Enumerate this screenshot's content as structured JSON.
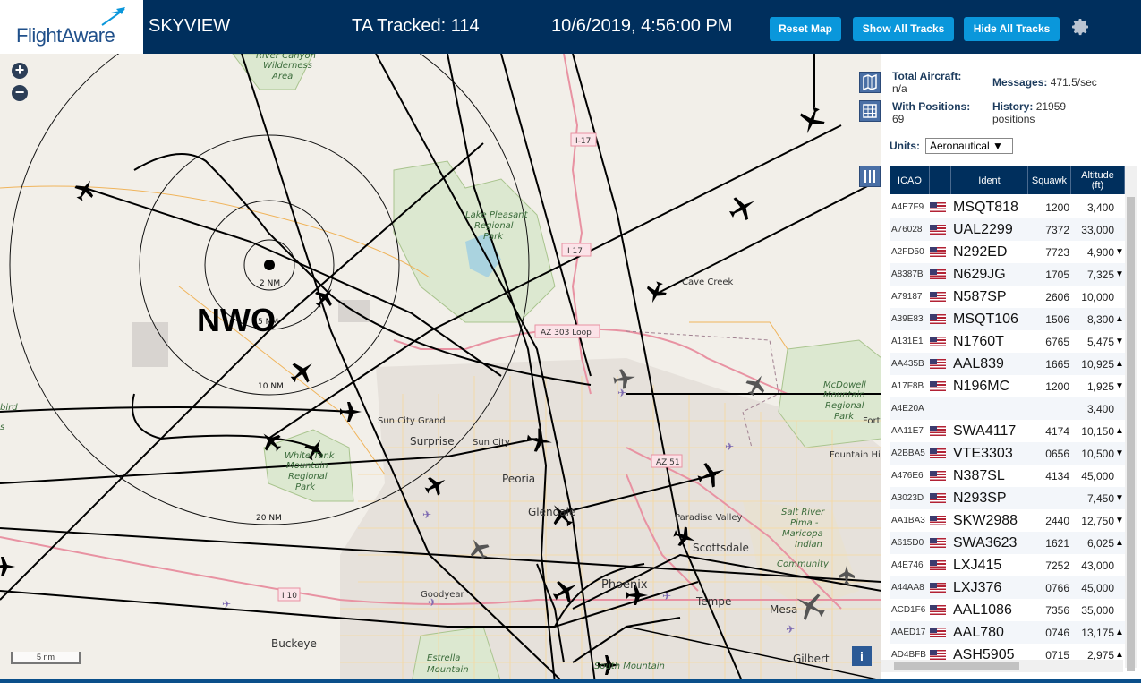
{
  "header": {
    "logo_text": "FlightAware",
    "app_title": "SKYVIEW",
    "tracked": "TA Tracked: 114",
    "datetime": "10/6/2019, 4:56:00 PM",
    "reset_label": "Reset Map",
    "show_label": "Show All Tracks",
    "hide_label": "Hide All Tracks",
    "brand_color": "#002f5d",
    "button_color": "#0a97db"
  },
  "map": {
    "zoom_in": "+",
    "zoom_out": "−",
    "scale_label": "5 nm",
    "info_label": "i",
    "station_label": "NWO",
    "ring_labels": [
      "2 NM",
      "5 NM",
      "10 NM",
      "20 NM"
    ],
    "places": [
      "River Canyon Wilderness Area",
      "Lake Pleasant Regional Park",
      "Cave Creek",
      "AZ 303 Loop",
      "McDowell Mountain Regional Park",
      "Sun City Grand",
      "Surprise",
      "Sun City",
      "White Tank Mountain Regional Park",
      "Peoria",
      "AZ 51",
      "Fountain Hills",
      "Glendale",
      "Paradise Valley",
      "Salt River Pima-Maricopa Indian Community",
      "Scottsdale",
      "I 10",
      "Goodyear",
      "Phoenix",
      "Tempe",
      "Mesa",
      "Buckeye",
      "Estrella Mountain",
      "Gilbert",
      "South Mountain",
      "I-17",
      "I 17",
      "Fort"
    ],
    "places_visible": [
      "River Canyon",
      "Wilderness",
      "Area",
      "Lake Pleasant",
      "Regional",
      "Park",
      "Cave Creek",
      "AZ 303 Loop",
      "McDowell",
      "Mountain",
      "Regional",
      "Park",
      "Sun City Grand",
      "Surprise",
      "Sun City",
      "White Tank",
      "Mountain",
      "Regional",
      "Park",
      "Peoria",
      "AZ 51",
      "Fountain Hills",
      "Glendale",
      "Paradise Valley",
      "Salt River",
      "Pima -",
      "Maricopa",
      "Indian",
      "Community",
      "Scottsdale",
      "I 10",
      "Goodyear",
      "Phoenix",
      "Tempe",
      "Mesa",
      "Buckeye",
      "Estrella",
      "Mountain",
      "Gilbert",
      "South Mountain",
      "I-17",
      "I 17",
      "Fort",
      "bird",
      "s"
    ]
  },
  "sidebar": {
    "total_aircraft_label": "Total Aircraft:",
    "total_aircraft_value": "n/a",
    "with_positions_label": "With Positions:",
    "with_positions_value": "69",
    "messages_label": "Messages:",
    "messages_value": "471.5/sec",
    "history_label": "History:",
    "history_value": "21959",
    "history_unit": "positions",
    "units_label": "Units:",
    "units_value": "Aeronautical ▼",
    "columns": {
      "icao": "ICAO",
      "ident": "Ident",
      "squawk": "Squawk",
      "altitude": "Altitude",
      "altitude_unit": "(ft)"
    },
    "rows": [
      {
        "icao": "A4E7F9",
        "ident": "MSQT818",
        "squawk": "1200",
        "alt": "3,400",
        "trend": ""
      },
      {
        "icao": "A76028",
        "ident": "UAL2299",
        "squawk": "7372",
        "alt": "33,000",
        "trend": ""
      },
      {
        "icao": "A2FD50",
        "ident": "N292ED",
        "squawk": "7723",
        "alt": "4,900",
        "trend": "▼"
      },
      {
        "icao": "A8387B",
        "ident": "N629JG",
        "squawk": "1705",
        "alt": "7,325",
        "trend": "▼"
      },
      {
        "icao": "A79187",
        "ident": "N587SP",
        "squawk": "2606",
        "alt": "10,000",
        "trend": ""
      },
      {
        "icao": "A39E83",
        "ident": "MSQT106",
        "squawk": "1506",
        "alt": "8,300",
        "trend": "▲"
      },
      {
        "icao": "A131E1",
        "ident": "N1760T",
        "squawk": "6765",
        "alt": "5,475",
        "trend": "▼"
      },
      {
        "icao": "AA435B",
        "ident": "AAL839",
        "squawk": "1665",
        "alt": "10,925",
        "trend": "▲"
      },
      {
        "icao": "A17F8B",
        "ident": "N196MC",
        "squawk": "1200",
        "alt": "1,925",
        "trend": "▼"
      },
      {
        "icao": "A4E20A",
        "ident": "",
        "squawk": "",
        "alt": "3,400",
        "trend": ""
      },
      {
        "icao": "AA11E7",
        "ident": "SWA4117",
        "squawk": "4174",
        "alt": "10,150",
        "trend": "▲"
      },
      {
        "icao": "A2BBA5",
        "ident": "VTE3303",
        "squawk": "0656",
        "alt": "10,500",
        "trend": "▼"
      },
      {
        "icao": "A476E6",
        "ident": "N387SL",
        "squawk": "4134",
        "alt": "45,000",
        "trend": ""
      },
      {
        "icao": "A3023D",
        "ident": "N293SP",
        "squawk": "",
        "alt": "7,450",
        "trend": "▼"
      },
      {
        "icao": "AA1BA3",
        "ident": "SKW2988",
        "squawk": "2440",
        "alt": "12,750",
        "trend": "▼"
      },
      {
        "icao": "A615D0",
        "ident": "SWA3623",
        "squawk": "1621",
        "alt": "6,025",
        "trend": "▲"
      },
      {
        "icao": "A4E746",
        "ident": "LXJ415",
        "squawk": "7252",
        "alt": "43,000",
        "trend": ""
      },
      {
        "icao": "A44AA8",
        "ident": "LXJ376",
        "squawk": "0766",
        "alt": "45,000",
        "trend": ""
      },
      {
        "icao": "ACD1F6",
        "ident": "AAL1086",
        "squawk": "7356",
        "alt": "35,000",
        "trend": ""
      },
      {
        "icao": "AAED17",
        "ident": "AAL780",
        "squawk": "0746",
        "alt": "13,175",
        "trend": "▲"
      },
      {
        "icao": "AD4BFB",
        "ident": "ASH5905",
        "squawk": "0715",
        "alt": "2,975",
        "trend": "▲"
      }
    ]
  }
}
